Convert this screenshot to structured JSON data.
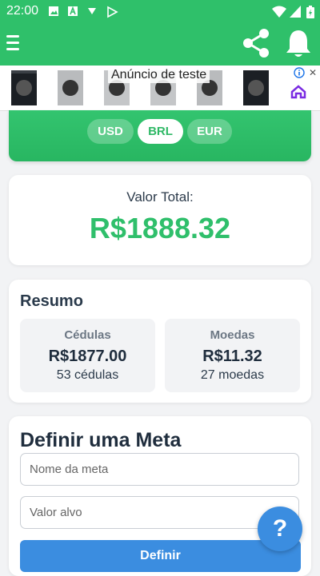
{
  "status_bar": {
    "time": "22:00"
  },
  "ad": {
    "label": "Anúncio de teste"
  },
  "currency": {
    "options": [
      "USD",
      "BRL",
      "EUR"
    ],
    "selected": "BRL"
  },
  "total": {
    "label": "Valor Total:",
    "value": "R$1888.32"
  },
  "summary": {
    "title": "Resumo",
    "notes": {
      "label": "Cédulas",
      "value": "R$1877.00",
      "count": "53 cédulas"
    },
    "coins": {
      "label": "Moedas",
      "value": "R$11.32",
      "count": "27 moedas"
    }
  },
  "goal": {
    "title": "Definir uma Meta",
    "name_placeholder": "Nome da meta",
    "value_placeholder": "Valor alvo",
    "button_label": "Definir"
  },
  "help": {
    "label": "?"
  },
  "colors": {
    "primary_green": "#2fc06a",
    "total_green": "#2fbf6b",
    "button_blue": "#3b8de0"
  },
  "icons": [
    "menu-icon",
    "share-icon",
    "bell-icon",
    "wifi-icon",
    "battery-icon",
    "ad-info-icon",
    "ad-close-icon"
  ]
}
